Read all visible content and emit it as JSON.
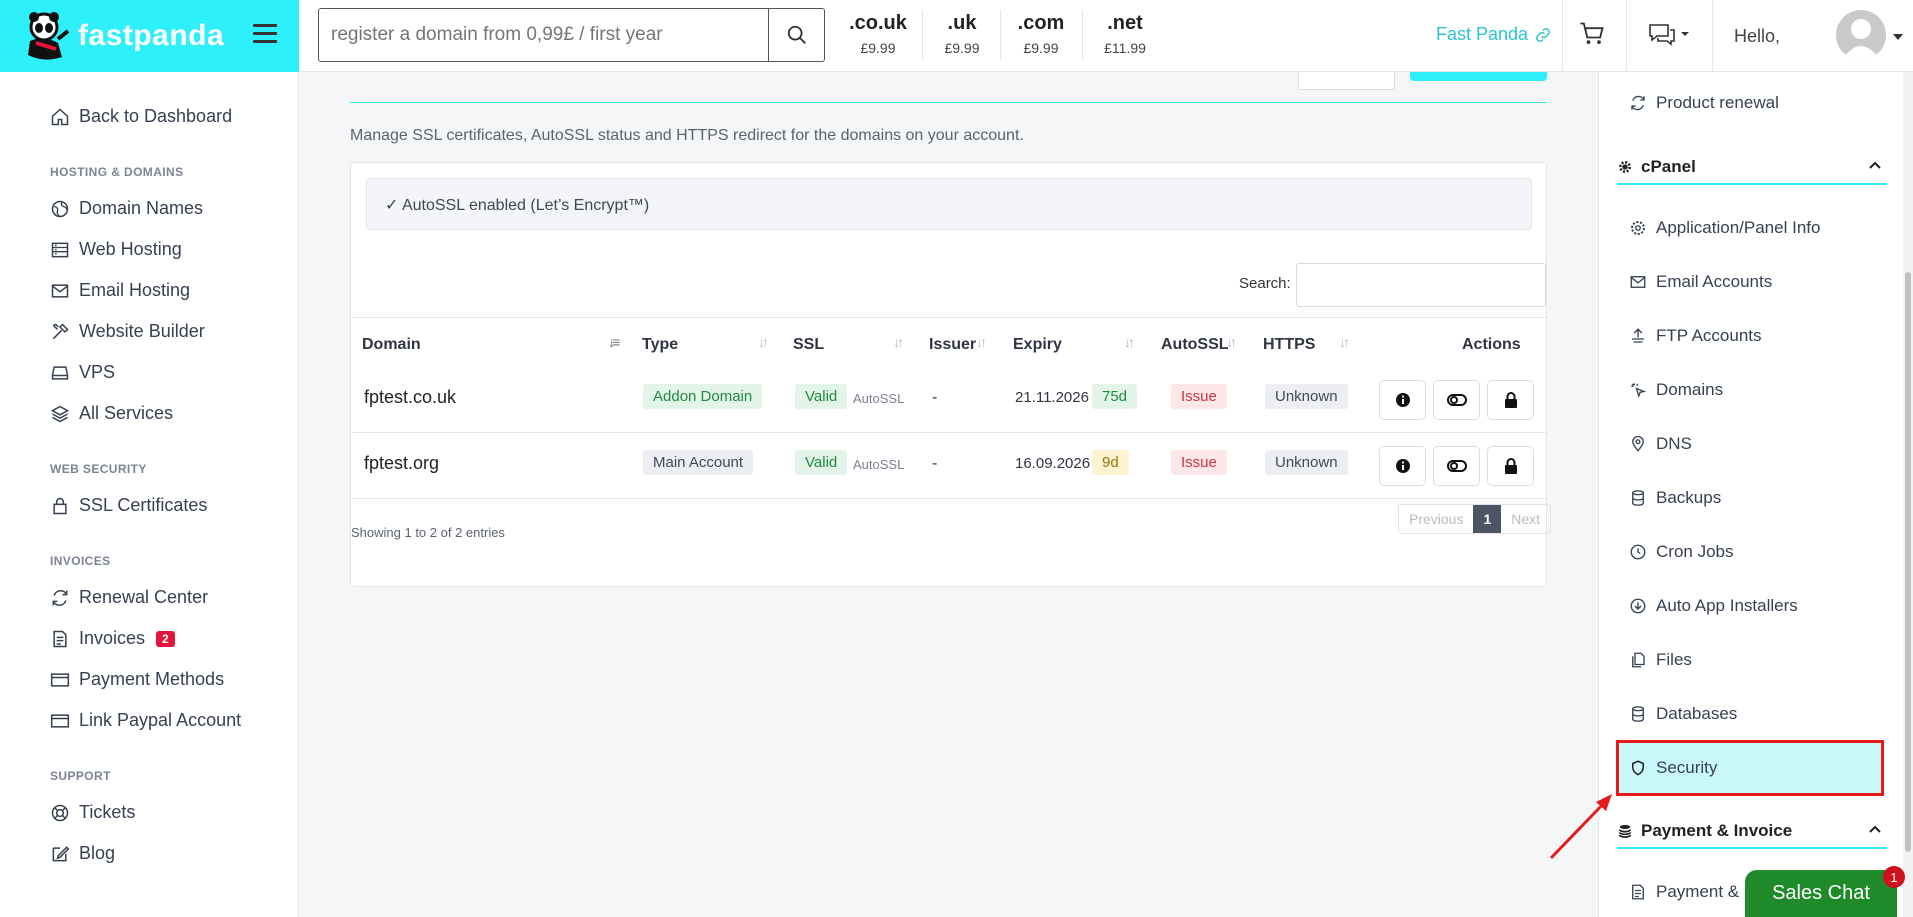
{
  "header": {
    "logo_text": "fastpanda",
    "search_placeholder": "register a domain from 0,99£ / first year",
    "tlds": [
      {
        "ext": ".co.uk",
        "price": "£9.99"
      },
      {
        "ext": ".uk",
        "price": "£9.99"
      },
      {
        "ext": ".com",
        "price": "£9.99"
      },
      {
        "ext": ".net",
        "price": "£11.99"
      }
    ],
    "brand_link": "Fast Panda",
    "greeting": "Hello,"
  },
  "sidebar": {
    "back": "Back to Dashboard",
    "sections": [
      {
        "heading": "HOSTING & DOMAINS",
        "items": [
          "Domain Names",
          "Web Hosting",
          "Email Hosting",
          "Website Builder",
          "VPS",
          "All Services"
        ]
      },
      {
        "heading": "WEB SECURITY",
        "items": [
          "SSL Certificates"
        ]
      },
      {
        "heading": "INVOICES",
        "items": [
          "Renewal Center",
          "Invoices",
          "Payment Methods",
          "Link Paypal Account"
        ]
      },
      {
        "heading": "SUPPORT",
        "items": [
          "Tickets",
          "Blog"
        ]
      }
    ],
    "invoices_badge": "2"
  },
  "main": {
    "description": "Manage SSL certificates, AutoSSL status and HTTPS redirect for the domains on your account.",
    "alert": "✓ AutoSSL enabled (Let’s Encrypt™)",
    "search_label": "Search:",
    "columns": [
      "Domain",
      "Type",
      "SSL",
      "Issuer",
      "Expiry",
      "AutoSSL",
      "HTTPS",
      "Actions"
    ],
    "rows": [
      {
        "domain": "fptest.co.uk",
        "type": "Addon Domain",
        "ssl": "Valid",
        "ssl_note": "AutoSSL",
        "issuer": "-",
        "expiry": "21.11.2026",
        "days": "75d",
        "autossl": "Issue",
        "https": "Unknown"
      },
      {
        "domain": "fptest.org",
        "type": "Main Account",
        "ssl": "Valid",
        "ssl_note": "AutoSSL",
        "issuer": "-",
        "expiry": "16.09.2026",
        "days": "9d",
        "autossl": "Issue",
        "https": "Unknown"
      }
    ],
    "showing": "Showing 1 to 2 of 2 entries",
    "pager": {
      "prev": "Previous",
      "page": "1",
      "next": "Next"
    }
  },
  "right_sidebar": {
    "product_renewal": "Product renewal",
    "cpanel_heading": "cPanel",
    "cpanel_items": [
      "Application/Panel Info",
      "Email Accounts",
      "FTP Accounts",
      "Domains",
      "DNS",
      "Backups",
      "Cron Jobs",
      "Auto App Installers",
      "Files",
      "Databases",
      "Security"
    ],
    "payment_heading": "Payment & Invoice",
    "payment_item": "Payment & I"
  },
  "chat": {
    "label": "Sales Chat",
    "badge": "1"
  },
  "colors": {
    "accent": "#2ef0fb",
    "highlight_border": "#e61a1a",
    "chat_green": "#1e8a2a"
  }
}
